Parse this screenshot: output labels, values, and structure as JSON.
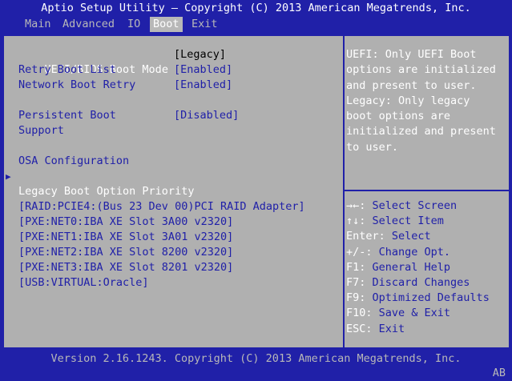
{
  "title": "Aptio Setup Utility – Copyright (C) 2013 American Megatrends, Inc.",
  "menu": {
    "main": "Main",
    "advanced": "Advanced",
    "io": "IO",
    "boot": "Boot",
    "exit": "Exit"
  },
  "settings": {
    "boot_mode": {
      "label": "UEFI/BIOS Boot Mode",
      "value": "[Legacy]"
    },
    "retry_boot_list": {
      "label": "Retry Boot List",
      "value": "[Enabled]"
    },
    "network_boot_retry": {
      "label": "Network Boot Retry",
      "value": "[Enabled]"
    },
    "persistent_boot": {
      "label_line1": "Persistent Boot",
      "label_line2": "Support",
      "value": "[Disabled]"
    },
    "osa_config": "OSA Configuration",
    "legacy_priority_heading": "Legacy Boot Option Priority",
    "boot_options": [
      "[RAID:PCIE4:(Bus 23 Dev 00)PCI RAID Adapter]",
      "[PXE:NET0:IBA XE Slot 3A00 v2320]",
      "[PXE:NET1:IBA XE Slot 3A01 v2320]",
      "[PXE:NET2:IBA XE Slot 8200 v2320]",
      "[PXE:NET3:IBA XE Slot 8201 v2320]",
      "[USB:VIRTUAL:Oracle]"
    ]
  },
  "help": {
    "lines": [
      "UEFI: Only UEFI Boot",
      "options are initialized",
      "and present to user.",
      "Legacy: Only legacy",
      "boot options are",
      "initialized and present",
      "to user."
    ]
  },
  "keys": [
    {
      "key": "→←:",
      "desc": " Select Screen"
    },
    {
      "key": "↑↓:",
      "desc": " Select Item"
    },
    {
      "key": "Enter:",
      "desc": " Select"
    },
    {
      "key": "+/-:",
      "desc": " Change Opt."
    },
    {
      "key": "F1:",
      "desc": " General Help"
    },
    {
      "key": "F7:",
      "desc": " Discard Changes"
    },
    {
      "key": "F9:",
      "desc": " Optimized Defaults"
    },
    {
      "key": "F10:",
      "desc": " Save & Exit"
    },
    {
      "key": "ESC:",
      "desc": " Exit"
    }
  ],
  "footer": "Version 2.16.1243. Copyright (C) 2013 American Megatrends, Inc.",
  "corner_badge": "AB",
  "colors": {
    "background": "#2020a8",
    "panel": "#b0b0b0",
    "text_white": "#ffffff",
    "text_blue": "#2020a8"
  }
}
